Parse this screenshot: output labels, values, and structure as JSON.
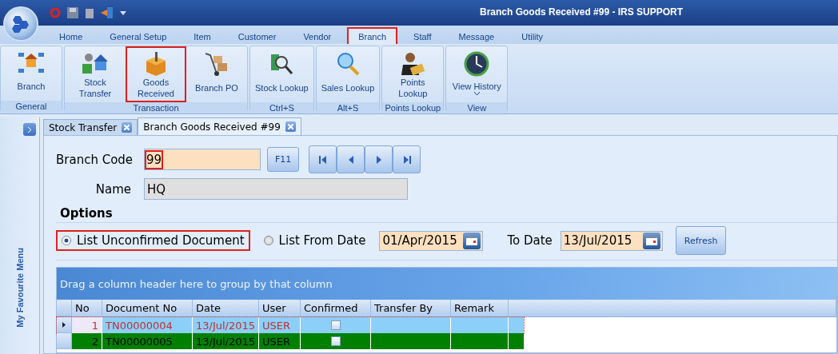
{
  "window": {
    "title": "Branch Goods Received #99 - IRS SUPPORT"
  },
  "menu_tabs": [
    {
      "label": "Home",
      "selected": false,
      "highlighted": false
    },
    {
      "label": "General Setup",
      "selected": false,
      "highlighted": false
    },
    {
      "label": "Item",
      "selected": false,
      "highlighted": false
    },
    {
      "label": "Customer",
      "selected": false,
      "highlighted": false
    },
    {
      "label": "Vendor",
      "selected": false,
      "highlighted": false
    },
    {
      "label": "Branch",
      "selected": true,
      "highlighted": true
    },
    {
      "label": "Staff",
      "selected": false,
      "highlighted": false
    },
    {
      "label": "Message",
      "selected": false,
      "highlighted": false
    },
    {
      "label": "Utility",
      "selected": false,
      "highlighted": false
    }
  ],
  "ribbon_groups": [
    {
      "label": "General",
      "buttons": [
        {
          "label": "Branch",
          "kind": "network",
          "highlighted": false
        }
      ]
    },
    {
      "label": "Transaction",
      "buttons": [
        {
          "label": "Stock Transfer",
          "kind": "houses",
          "highlighted": false
        },
        {
          "label": "Goods Received",
          "kind": "box",
          "highlighted": true
        },
        {
          "label": "Branch PO",
          "kind": "trolley",
          "highlighted": false
        }
      ]
    },
    {
      "label": "Ctrl+S",
      "buttons": [
        {
          "label": "Stock Lookup",
          "kind": "stocklookup",
          "highlighted": false
        }
      ]
    },
    {
      "label": "Alt+S",
      "buttons": [
        {
          "label": "Sales Lookup",
          "kind": "saleslookup",
          "highlighted": false
        }
      ]
    },
    {
      "label": "Points Lookup",
      "buttons": [
        {
          "label": "Points Lookup",
          "kind": "points",
          "highlighted": false
        }
      ]
    },
    {
      "label": "View",
      "buttons": [
        {
          "label": "View History",
          "kind": "history",
          "highlighted": false,
          "dropdown": true
        }
      ]
    }
  ],
  "sidebar": {
    "title": "My Favourite Menu"
  },
  "doc_tabs": [
    {
      "label": "Stock Transfer",
      "selected": false
    },
    {
      "label": "Branch Goods Received #99",
      "selected": true
    }
  ],
  "form": {
    "branch_code": {
      "label": "Branch Code",
      "value": "99",
      "highlighted": true
    },
    "lookup_button": "F11",
    "name": {
      "label": "Name",
      "value": "HQ",
      "disabled": true
    }
  },
  "options": {
    "title": "Options",
    "radios": [
      {
        "label": "List Unconfirmed Document",
        "selected": true,
        "highlighted": true
      },
      {
        "label": "List From Date",
        "selected": false,
        "highlighted": false
      }
    ],
    "from_date": "01/Apr/2015",
    "to_date_label": "To Date",
    "to_date": "13/Jul/2015",
    "refresh_button": "Refresh"
  },
  "grid": {
    "group_hint": "Drag a column header here to group by that column",
    "columns": [
      "No",
      "Document No",
      "Date",
      "User",
      "Confirmed",
      "Transfer By",
      "Remark"
    ],
    "rows": [
      {
        "no": "1",
        "document_no": "TN00000004",
        "date": "13/Jul/2015",
        "user": "USER",
        "confirmed": false,
        "selected": true,
        "color": "#8ccff8"
      },
      {
        "no": "2",
        "document_no": "TN00000005",
        "date": "13/Jul/2015",
        "user": "USER",
        "confirmed": false,
        "selected": false,
        "color": "#008000"
      }
    ]
  }
}
